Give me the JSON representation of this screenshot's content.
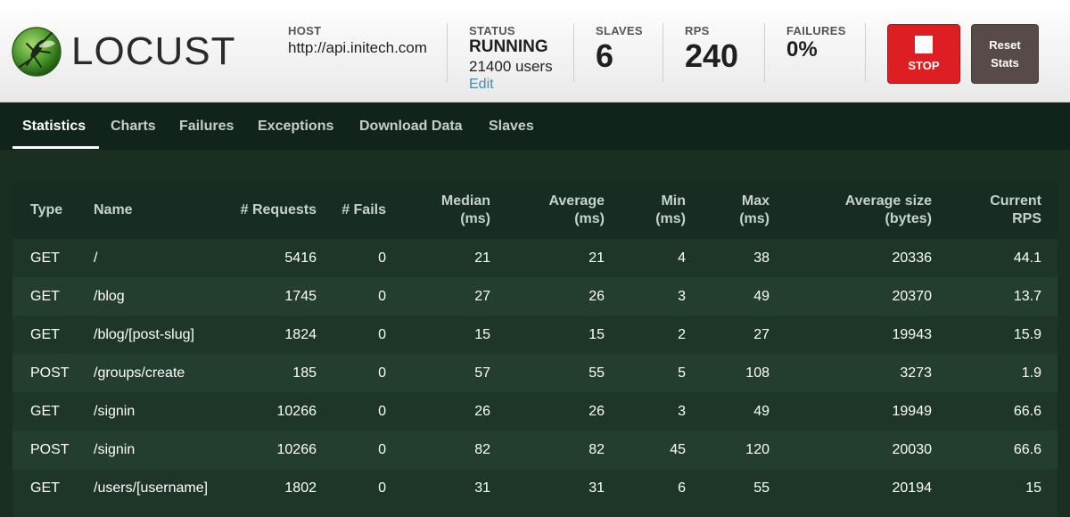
{
  "header": {
    "logo_text": "LOCUST",
    "host_label": "HOST",
    "host_value": "http://api.initech.com",
    "status_label": "STATUS",
    "status_value": "RUNNING",
    "users_text": "21400 users",
    "edit_label": "Edit",
    "slaves_label": "SLAVES",
    "slaves_value": "6",
    "rps_label": "RPS",
    "rps_value": "240",
    "failures_label": "FAILURES",
    "failures_value": "0%",
    "stop_label": "STOP",
    "reset_label_line1": "Reset",
    "reset_label_line2": "Stats"
  },
  "colors": {
    "stop_button": "#dd1f24",
    "reset_button": "#584a48",
    "background": "#1a2e22",
    "edit_link": "#3d8cc4"
  },
  "tabs": [
    {
      "label": "Statistics",
      "active": true
    },
    {
      "label": "Charts",
      "active": false
    },
    {
      "label": "Failures",
      "active": false
    },
    {
      "label": "Exceptions",
      "active": false
    },
    {
      "label": "Download Data",
      "active": false
    },
    {
      "label": "Slaves",
      "active": false
    }
  ],
  "table": {
    "headers": {
      "type": "Type",
      "name": "Name",
      "requests": "# Requests",
      "fails": "# Fails",
      "median_1": "Median",
      "median_2": "(ms)",
      "average_1": "Average",
      "average_2": "(ms)",
      "min_1": "Min",
      "min_2": "(ms)",
      "max_1": "Max",
      "max_2": "(ms)",
      "size_1": "Average size",
      "size_2": "(bytes)",
      "rps_1": "Current",
      "rps_2": "RPS"
    },
    "rows": [
      {
        "type": "GET",
        "name": "/",
        "requests": "5416",
        "fails": "0",
        "median": "21",
        "average": "21",
        "min": "4",
        "max": "38",
        "size": "20336",
        "rps": "44.1"
      },
      {
        "type": "GET",
        "name": "/blog",
        "requests": "1745",
        "fails": "0",
        "median": "27",
        "average": "26",
        "min": "3",
        "max": "49",
        "size": "20370",
        "rps": "13.7"
      },
      {
        "type": "GET",
        "name": "/blog/[post-slug]",
        "requests": "1824",
        "fails": "0",
        "median": "15",
        "average": "15",
        "min": "2",
        "max": "27",
        "size": "19943",
        "rps": "15.9"
      },
      {
        "type": "POST",
        "name": "/groups/create",
        "requests": "185",
        "fails": "0",
        "median": "57",
        "average": "55",
        "min": "5",
        "max": "108",
        "size": "3273",
        "rps": "1.9"
      },
      {
        "type": "GET",
        "name": "/signin",
        "requests": "10266",
        "fails": "0",
        "median": "26",
        "average": "26",
        "min": "3",
        "max": "49",
        "size": "19949",
        "rps": "66.6"
      },
      {
        "type": "POST",
        "name": "/signin",
        "requests": "10266",
        "fails": "0",
        "median": "82",
        "average": "82",
        "min": "45",
        "max": "120",
        "size": "20030",
        "rps": "66.6"
      },
      {
        "type": "GET",
        "name": "/users/[username]",
        "requests": "1802",
        "fails": "0",
        "median": "31",
        "average": "31",
        "min": "6",
        "max": "55",
        "size": "20194",
        "rps": "15"
      }
    ]
  }
}
